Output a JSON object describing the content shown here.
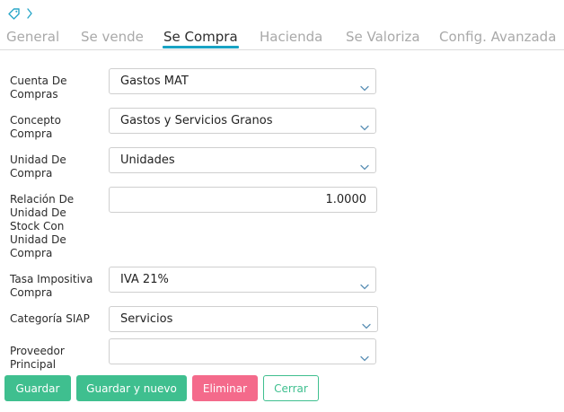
{
  "breadcrumb": {
    "icon": "tag-icon",
    "separator": "chevron-right-icon"
  },
  "tabs": [
    {
      "label": "General"
    },
    {
      "label": "Se vende"
    },
    {
      "label": "Se Compra"
    },
    {
      "label": "Hacienda"
    },
    {
      "label": "Se Valoriza"
    },
    {
      "label": "Config. Avanzada"
    }
  ],
  "active_tab": "Se Compra",
  "form": {
    "cuenta_compras": {
      "label": "Cuenta De Compras",
      "value": "Gastos MAT"
    },
    "concepto_compra": {
      "label": "Concepto Compra",
      "value": "Gastos y Servicios Granos"
    },
    "unidad_compra": {
      "label": "Unidad De Compra",
      "value": "Unidades"
    },
    "relacion_unidad": {
      "label": "Relación De Unidad De Stock Con Unidad De Compra",
      "value": "1.0000"
    },
    "tasa_impositiva": {
      "label": "Tasa Impositiva Compra",
      "value": "IVA 21%"
    },
    "categoria_siap": {
      "label": "Categoría SIAP",
      "value": "Servicios"
    },
    "proveedor_principal": {
      "label": "Proveedor Principal",
      "value": ""
    }
  },
  "buttons": {
    "guardar": "Guardar",
    "guardar_nuevo": "Guardar y nuevo",
    "eliminar": "Eliminar",
    "cerrar": "Cerrar"
  },
  "colors": {
    "accent": "#19a3c4",
    "success": "#3fbf8f",
    "danger": "#f46a8b",
    "tab_inactive": "#a9a9a9"
  }
}
